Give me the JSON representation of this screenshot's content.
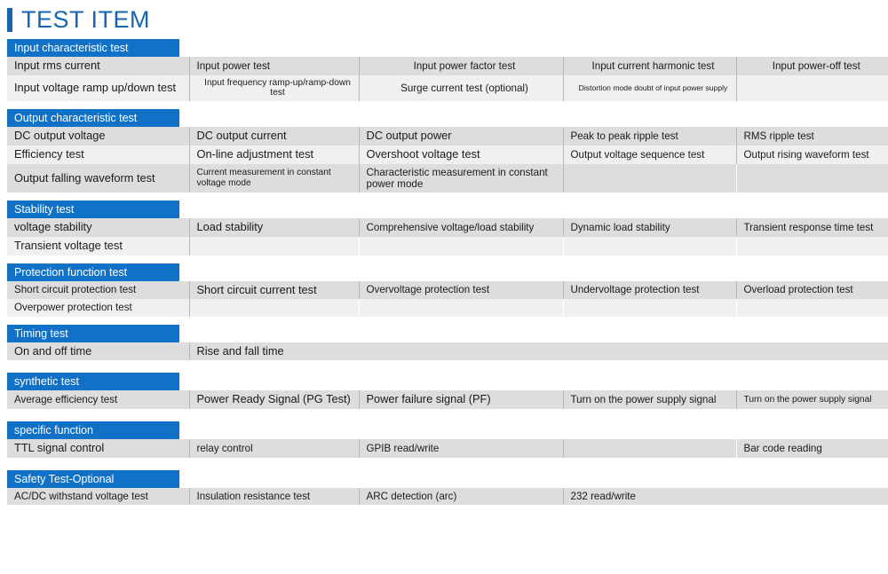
{
  "page": {
    "title": "TEST ITEM",
    "accent_color": "#1565b0",
    "header_color": "#1071c6",
    "row_color_a": "#dddddd",
    "row_color_b": "#f0f0f0"
  },
  "sections": [
    {
      "id": "input-characteristic-test",
      "header": "Input characteristic test",
      "rows": [
        {
          "cells": [
            {
              "text": "Input rms current",
              "size": "t-lg"
            },
            {
              "text": "Input power test",
              "size": "t-md"
            },
            {
              "text": "Input power factor test",
              "size": "t-md",
              "align": "center"
            },
            {
              "text": "Input current harmonic test",
              "size": "t-md",
              "align": "center"
            },
            {
              "text": "Input power-off test",
              "size": "t-md",
              "align": "center"
            }
          ]
        },
        {
          "cells": [
            {
              "text": "Input voltage ramp up/down test",
              "size": "t-lg"
            },
            {
              "text": "Input frequency ramp-up/ramp-down test",
              "size": "t-sm",
              "align": "center"
            },
            {
              "text": "Surge current test (optional)",
              "size": "t-md",
              "align": "center"
            },
            {
              "text": "Distortion mode doubt of input power supply",
              "size": "t-xs",
              "align": "center"
            },
            {
              "text": "",
              "size": "t-md"
            }
          ]
        }
      ]
    },
    {
      "id": "output-characteristic-test",
      "header": "Output characteristic test",
      "rows": [
        {
          "cells": [
            {
              "text": "DC output voltage",
              "size": "t-lg"
            },
            {
              "text": "DC output current",
              "size": "t-lg"
            },
            {
              "text": "DC output power",
              "size": "t-lg"
            },
            {
              "text": "Peak to peak ripple test",
              "size": "t-md"
            },
            {
              "text": "RMS ripple test",
              "size": "t-md"
            }
          ]
        },
        {
          "cells": [
            {
              "text": "Efficiency test",
              "size": "t-lg"
            },
            {
              "text": "On-line adjustment test",
              "size": "t-lg"
            },
            {
              "text": "Overshoot voltage test",
              "size": "t-lg"
            },
            {
              "text": "Output voltage sequence test",
              "size": "t-md"
            },
            {
              "text": "Output rising waveform test",
              "size": "t-md"
            }
          ]
        },
        {
          "cells": [
            {
              "text": "Output falling waveform test",
              "size": "t-lg"
            },
            {
              "text": "Current measurement in constant voltage mode",
              "size": "t-sm"
            },
            {
              "text": "Characteristic measurement in constant power mode",
              "size": "t-md"
            },
            {
              "text": "",
              "size": "t-md"
            },
            {
              "text": "",
              "size": "t-md"
            }
          ]
        }
      ]
    },
    {
      "id": "stability-test",
      "header": "Stability test",
      "rows": [
        {
          "cells": [
            {
              "text": "voltage stability",
              "size": "t-lg"
            },
            {
              "text": "Load stability",
              "size": "t-lg"
            },
            {
              "text": "Comprehensive voltage/load stability",
              "size": "t-md"
            },
            {
              "text": "Dynamic load stability",
              "size": "t-md"
            },
            {
              "text": "Transient response time test",
              "size": "t-md"
            }
          ]
        },
        {
          "cells": [
            {
              "text": "Transient voltage test",
              "size": "t-lg"
            },
            {
              "text": "",
              "size": "t-md"
            },
            {
              "text": "",
              "size": "t-md"
            },
            {
              "text": "",
              "size": "t-md"
            },
            {
              "text": "",
              "size": "t-md"
            }
          ]
        }
      ]
    },
    {
      "id": "protection-function-test",
      "header": "Protection function test",
      "rows": [
        {
          "cells": [
            {
              "text": "Short circuit protection test",
              "size": "t-md"
            },
            {
              "text": "Short circuit current test",
              "size": "t-lg"
            },
            {
              "text": "Overvoltage protection test",
              "size": "t-md"
            },
            {
              "text": "Undervoltage protection test",
              "size": "t-md"
            },
            {
              "text": "Overload protection test",
              "size": "t-md"
            }
          ]
        },
        {
          "cells": [
            {
              "text": "Overpower protection test",
              "size": "t-md"
            },
            {
              "text": "",
              "size": "t-md"
            },
            {
              "text": "",
              "size": "t-md"
            },
            {
              "text": "",
              "size": "t-md"
            },
            {
              "text": "",
              "size": "t-md"
            }
          ]
        }
      ]
    },
    {
      "id": "timing-test",
      "header": "Timing test",
      "rows": [
        {
          "cells": [
            {
              "text": "On and off time",
              "size": "t-lg"
            },
            {
              "text": "Rise and fall time",
              "size": "t-lg",
              "span": 4
            }
          ]
        }
      ]
    },
    {
      "id": "synthetic-test",
      "header": "synthetic test",
      "rows": [
        {
          "cells": [
            {
              "text": "Average efficiency test",
              "size": "t-md"
            },
            {
              "text": "Power Ready Signal (PG Test)",
              "size": "t-lg"
            },
            {
              "text": "Power failure signal (PF)",
              "size": "t-lg"
            },
            {
              "text": "Turn on the power supply signal",
              "size": "t-md"
            },
            {
              "text": "Turn on the power supply signal",
              "size": "t-sm"
            }
          ]
        }
      ]
    },
    {
      "id": "specific-function",
      "header": "specific function",
      "rows": [
        {
          "cells": [
            {
              "text": "TTL signal control",
              "size": "t-lg"
            },
            {
              "text": "relay control",
              "size": "t-md"
            },
            {
              "text": "GPIB read/write",
              "size": "t-md"
            },
            {
              "text": "",
              "size": "t-md"
            },
            {
              "text": "Bar code reading",
              "size": "t-md"
            }
          ]
        }
      ]
    },
    {
      "id": "safety-test-optional",
      "header": "Safety Test-Optional",
      "rows": [
        {
          "cells": [
            {
              "text": "AC/DC withstand voltage test",
              "size": "t-md"
            },
            {
              "text": "Insulation resistance test",
              "size": "t-md"
            },
            {
              "text": "ARC detection (arc)",
              "size": "t-md"
            },
            {
              "text": "232 read/write",
              "size": "t-md",
              "span": 2
            }
          ]
        }
      ]
    }
  ]
}
